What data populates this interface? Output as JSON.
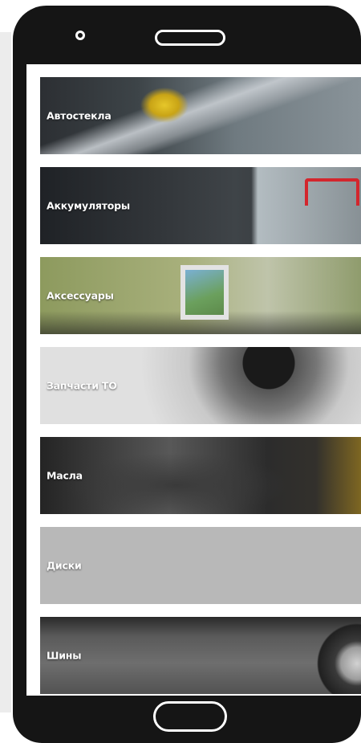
{
  "categories": [
    {
      "label": "Автостекла"
    },
    {
      "label": "Аккумуляторы"
    },
    {
      "label": "Аксессуары"
    },
    {
      "label": "Запчасти ТО"
    },
    {
      "label": "Масла"
    },
    {
      "label": "Диски"
    },
    {
      "label": "Шины"
    }
  ]
}
